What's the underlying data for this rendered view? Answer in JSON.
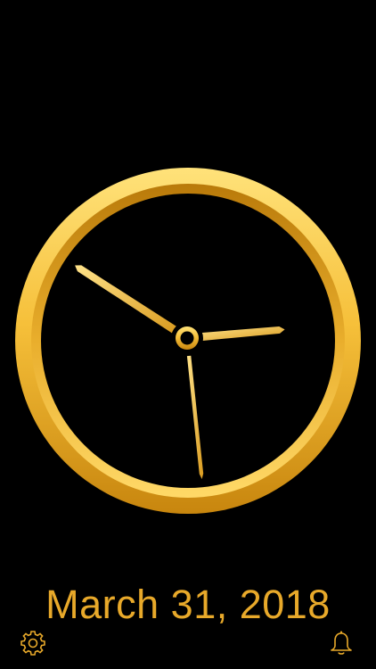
{
  "clock": {
    "date_label": "March 31, 2018",
    "hour": 2,
    "minute": 50,
    "second": 29,
    "accent_color": "#e8a92a",
    "ring_colors": {
      "light": "#ffe27a",
      "mid": "#f6c03a",
      "dark": "#c8860e"
    },
    "background": "#000000"
  },
  "toolbar": {
    "settings_icon": "gear-icon",
    "alarm_icon": "bell-icon"
  }
}
